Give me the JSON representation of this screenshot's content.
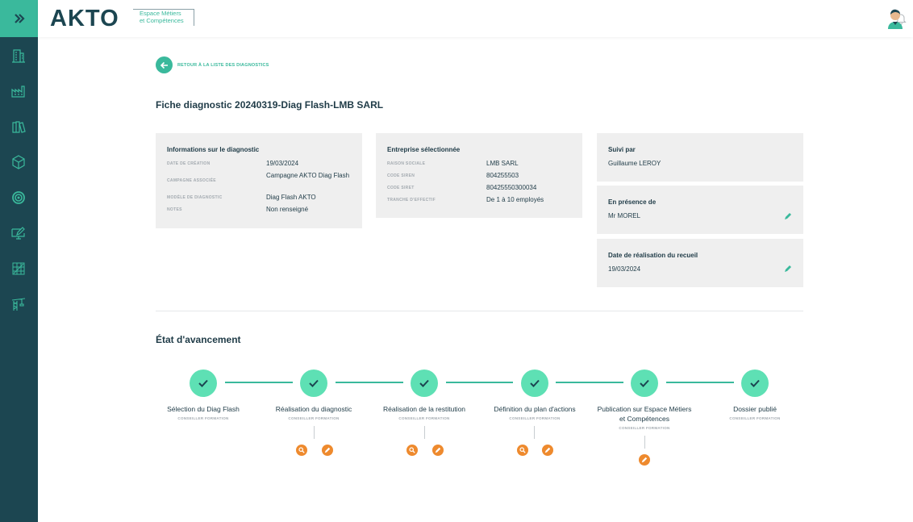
{
  "brand": {
    "logo": "AKTO",
    "subtitle_line1": "Espace Métiers",
    "subtitle_line2": "et Compétences"
  },
  "back_link": "RETOUR À LA LISTE DES DIAGNOSTICS",
  "page_title": "Fiche diagnostic 20240319-Diag Flash-LMB SARL",
  "diagnostic_info": {
    "title": "Informations sur le diagnostic",
    "rows": [
      {
        "label": "DATE DE CRÉATION",
        "value": "19/03/2024"
      },
      {
        "label": "CAMPAGNE ASSOCIÉE",
        "value": "Campagne AKTO Diag Flash"
      },
      {
        "label": "MODÈLE DE DIAGNOSTIC",
        "value": "Diag Flash AKTO"
      },
      {
        "label": "NOTES",
        "value": "Non renseigné"
      }
    ]
  },
  "company_info": {
    "title": "Entreprise sélectionnée",
    "rows": [
      {
        "label": "RAISON SOCIALE",
        "value": "LMB SARL"
      },
      {
        "label": "CODE SIREN",
        "value": "804255503"
      },
      {
        "label": "CODE SIRET",
        "value": "80425550300034"
      },
      {
        "label": "TRANCHE D'EFFECTIF",
        "value": "De 1 à 10 employés"
      }
    ]
  },
  "followed_by": {
    "title": "Suivi par",
    "value": "Guillaume LEROY"
  },
  "presence": {
    "title": "En présence de",
    "value": "Mr MOREL"
  },
  "collection_date": {
    "title": "Date de réalisation du recueil",
    "value": "19/03/2024"
  },
  "progress": {
    "title": "État d'avancement",
    "steps": [
      {
        "label": "Sélection du Diag Flash",
        "role": "CONSEILLER FORMATION",
        "done": true
      },
      {
        "label": "Réalisation du diagnostic",
        "role": "CONSEILLER FORMATION",
        "done": true
      },
      {
        "label": "Réalisation de la restitution",
        "role": "CONSEILLER FORMATION",
        "done": true
      },
      {
        "label": "Définition du plan d'actions",
        "role": "CONSEILLER FORMATION",
        "done": true
      },
      {
        "label": "Publication sur Espace Métiers et Compétences",
        "role": "CONSEILLER FORMATION",
        "done": true
      },
      {
        "label": "Dossier publié",
        "role": "CONSEILLER FORMATION",
        "done": true
      }
    ]
  },
  "colors": {
    "sidebar": "#1c4651",
    "accent": "#3ab99c",
    "step": "#5ee0b4",
    "action": "#ee8a2e",
    "card": "#efefef"
  },
  "icons": [
    "chevrons-right-icon",
    "building-icon",
    "factory-icon",
    "books-icon",
    "box-icon",
    "target-icon",
    "monitor-edit-icon",
    "chart-grid-icon",
    "crane-icon",
    "bell-icon",
    "user-avatar-icon",
    "arrow-left-icon",
    "pencil-icon",
    "check-icon",
    "search-icon"
  ]
}
